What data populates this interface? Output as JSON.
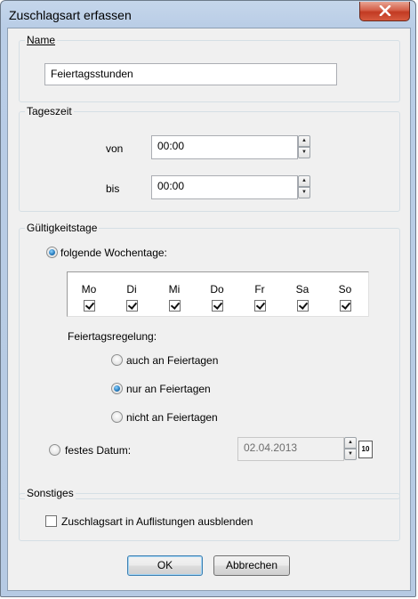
{
  "window": {
    "title": "Zuschlagsart erfassen"
  },
  "name_group": {
    "label": "Name",
    "value": "Feiertagsstunden"
  },
  "tageszeit_group": {
    "label": "Tageszeit",
    "von_label": "von",
    "von_value": "00:00",
    "bis_label": "bis",
    "bis_value": "00:00"
  },
  "gueltigkeit_group": {
    "label": "Gültigkeitstage",
    "wochentage_option": {
      "label": "folgende Wochentage:",
      "selected": true
    },
    "days": [
      {
        "label": "Mo",
        "checked": true
      },
      {
        "label": "Di",
        "checked": true
      },
      {
        "label": "Mi",
        "checked": true
      },
      {
        "label": "Do",
        "checked": true
      },
      {
        "label": "Fr",
        "checked": true
      },
      {
        "label": "Sa",
        "checked": true
      },
      {
        "label": "So",
        "checked": true
      }
    ],
    "feiertagsregelung_label": "Feiertagsregelung:",
    "feiertag_options": [
      {
        "label": "auch an Feiertagen",
        "selected": false
      },
      {
        "label": "nur an Feiertagen",
        "selected": true
      },
      {
        "label": "nicht an Feiertagen",
        "selected": false
      }
    ],
    "festes_datum_option": {
      "label": "festes Datum:",
      "selected": false
    },
    "datum_value": "02.04.2013",
    "calendar_button_label": "10"
  },
  "sonstiges_group": {
    "label": "Sonstiges",
    "ausblenden_checkbox": {
      "label": "Zuschlagsart in Auflistungen ausblenden",
      "checked": false
    }
  },
  "buttons": {
    "ok_label": "OK",
    "cancel_label": "Abbrechen"
  }
}
